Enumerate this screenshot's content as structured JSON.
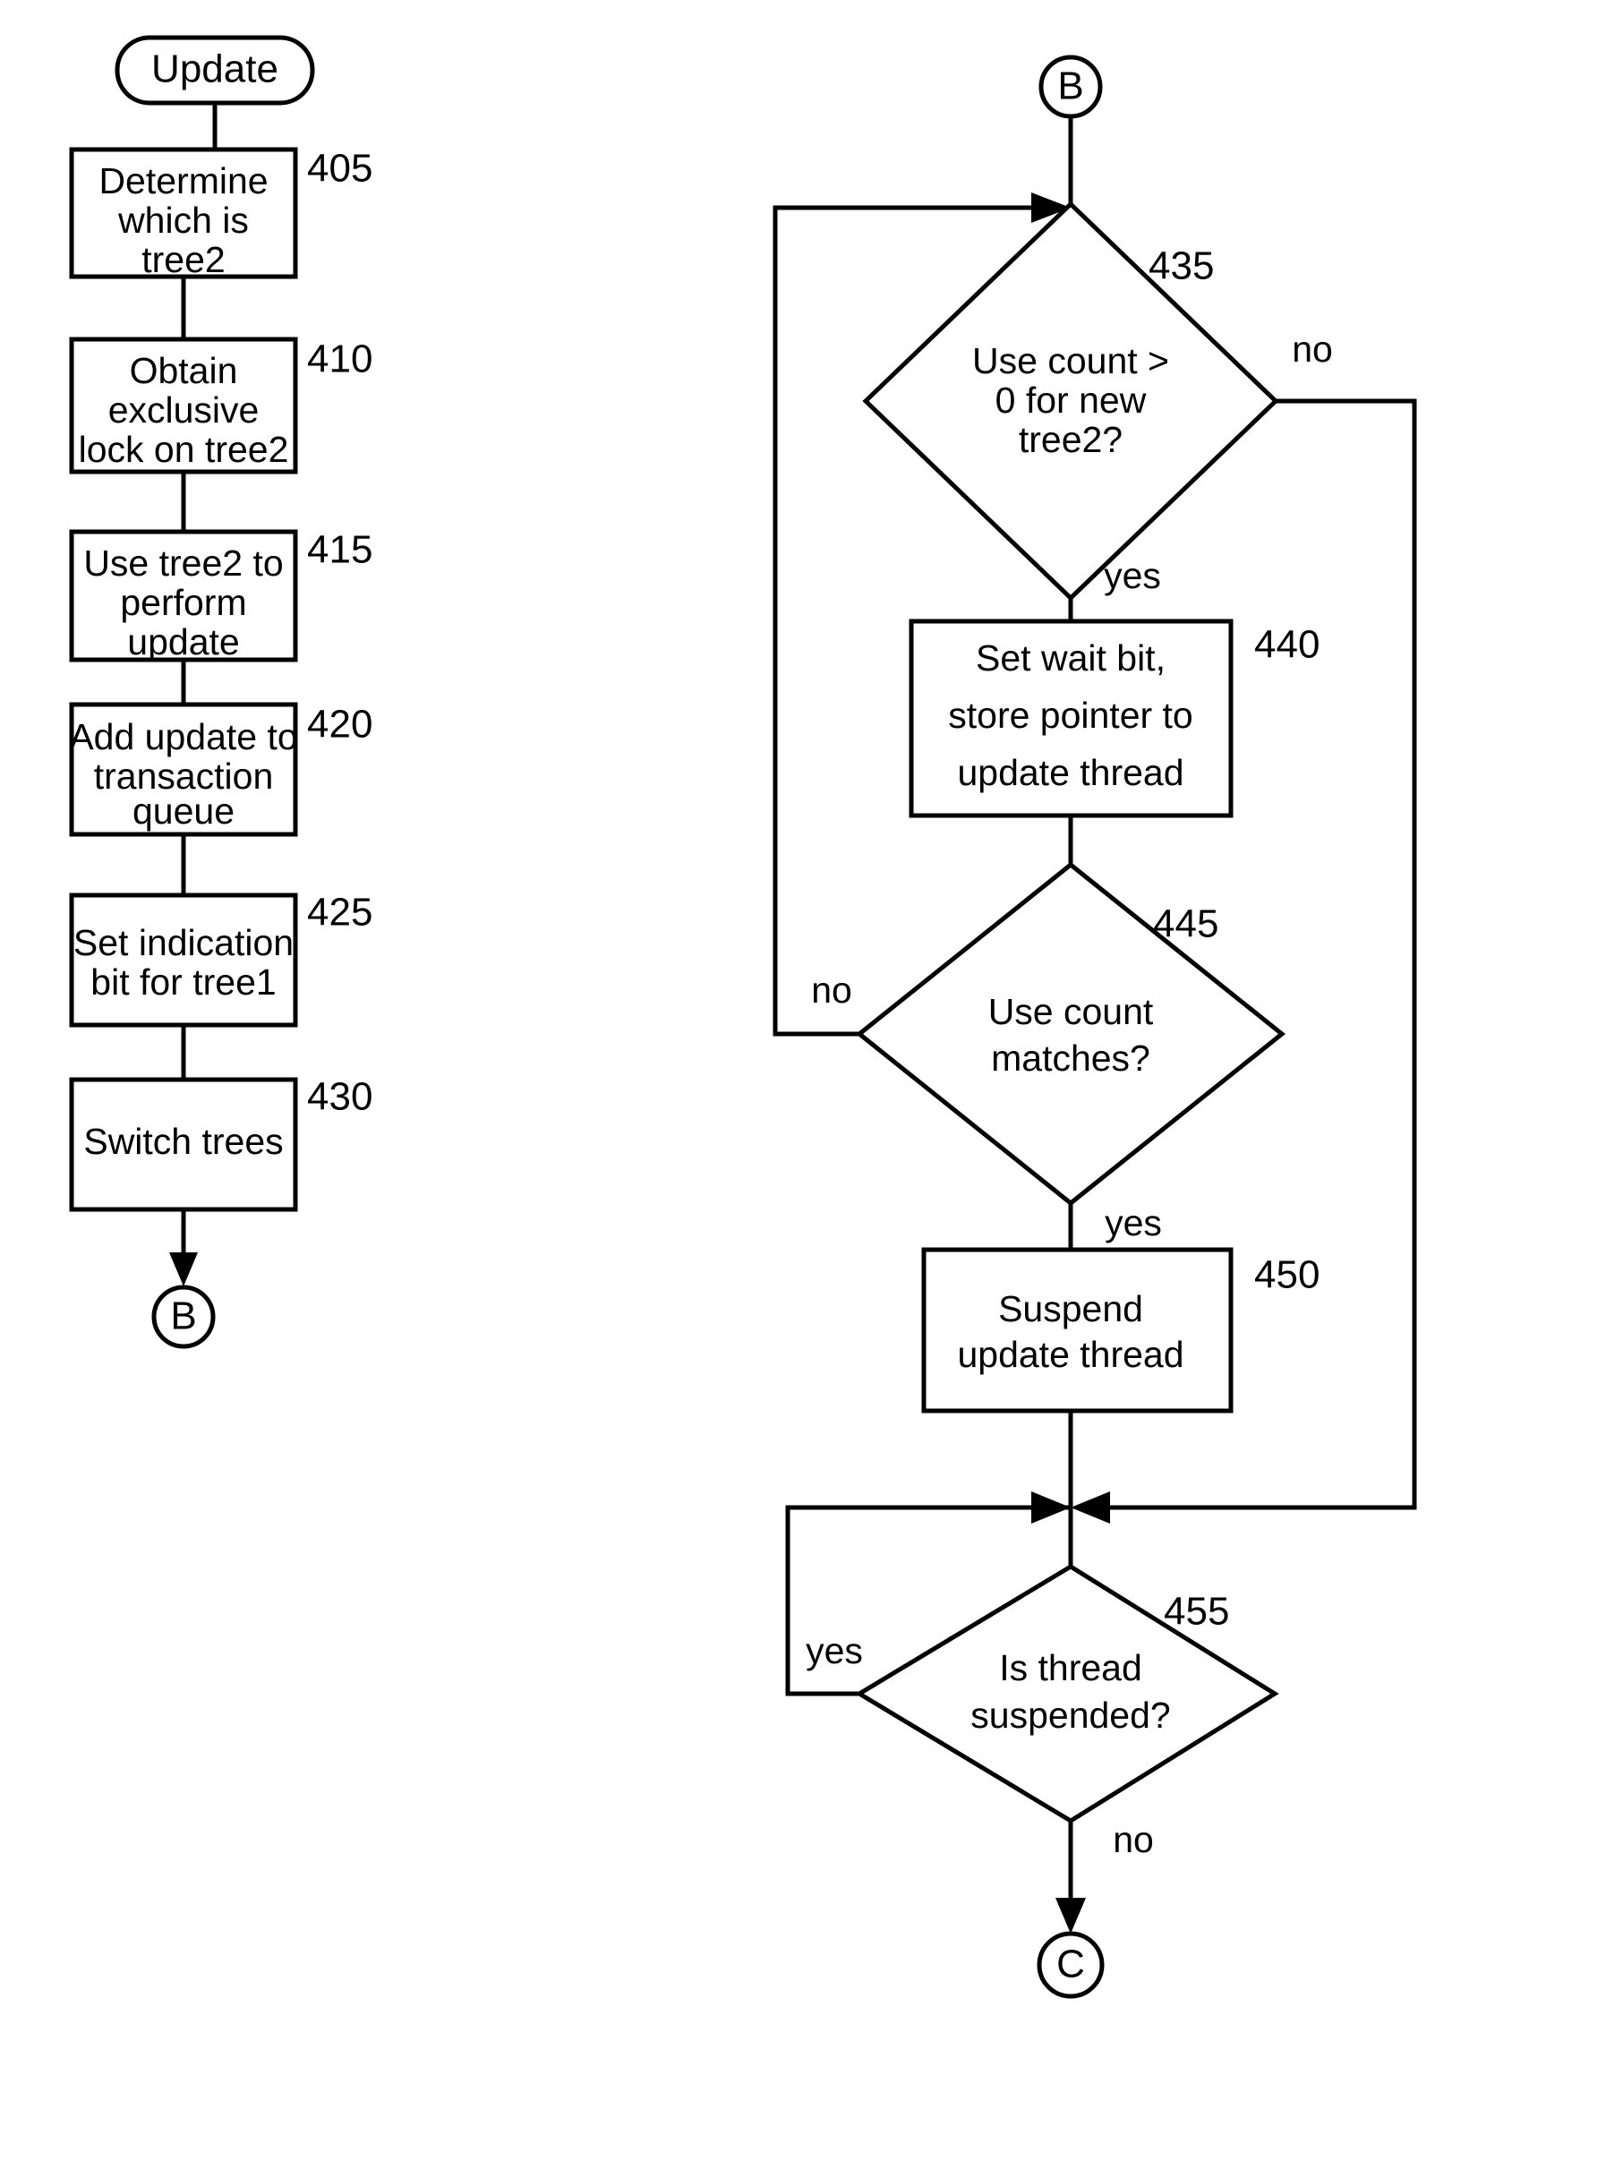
{
  "figure": {
    "type": "flowchart",
    "title": "",
    "background_color": "#ffffff",
    "line_color": "#000000"
  },
  "left_column": {
    "start_terminator": {
      "label": "Update",
      "shape": "stadium"
    },
    "steps": [
      {
        "ref": "405",
        "lines": [
          "Determine",
          "which is",
          "tree2"
        ],
        "shape": "process"
      },
      {
        "ref": "410",
        "lines": [
          "Obtain",
          "exclusive",
          "lock on tree2"
        ],
        "shape": "process"
      },
      {
        "ref": "415",
        "lines": [
          "Use tree2 to",
          "perform",
          "update"
        ],
        "shape": "process"
      },
      {
        "ref": "420",
        "lines": [
          "Add update to",
          "transaction",
          "queue"
        ],
        "shape": "process"
      },
      {
        "ref": "425",
        "lines": [
          "Set indication",
          "bit for tree1"
        ],
        "shape": "process"
      },
      {
        "ref": "430",
        "lines": [
          "Switch trees"
        ],
        "shape": "process"
      }
    ],
    "end_terminator": {
      "label": "B",
      "shape": "circle"
    }
  },
  "right_column": {
    "start_terminator": {
      "label": "B",
      "shape": "circle"
    },
    "steps": [
      {
        "ref": "435",
        "lines": [
          "Use count >",
          "0 for new",
          "tree2?"
        ],
        "shape": "decision",
        "yes_label": "yes",
        "no_label": "no"
      },
      {
        "ref": "440",
        "lines": [
          "Set wait bit,",
          "store pointer to",
          "update thread"
        ],
        "shape": "process"
      },
      {
        "ref": "445",
        "lines": [
          "Use count",
          "matches?"
        ],
        "shape": "decision",
        "yes_label": "yes",
        "no_label": "no"
      },
      {
        "ref": "450",
        "lines": [
          "Suspend",
          "update thread"
        ],
        "shape": "process"
      },
      {
        "ref": "455",
        "lines": [
          "Is thread",
          "suspended?"
        ],
        "shape": "decision",
        "yes_label": "yes",
        "no_label": "no"
      }
    ],
    "end_terminator": {
      "label": "C",
      "shape": "circle"
    }
  },
  "edge_labels": {
    "d435_yes": "yes",
    "d435_no": "no",
    "d445_no": "no",
    "d445_yes": "yes",
    "d455_yes": "yes",
    "d455_no": "no"
  },
  "ref_numbers": {
    "n405": "405",
    "n410": "410",
    "n415": "415",
    "n420": "420",
    "n425": "425",
    "n430": "430",
    "n435": "435",
    "n440": "440",
    "n445": "445",
    "n450": "450",
    "n455": "455"
  }
}
